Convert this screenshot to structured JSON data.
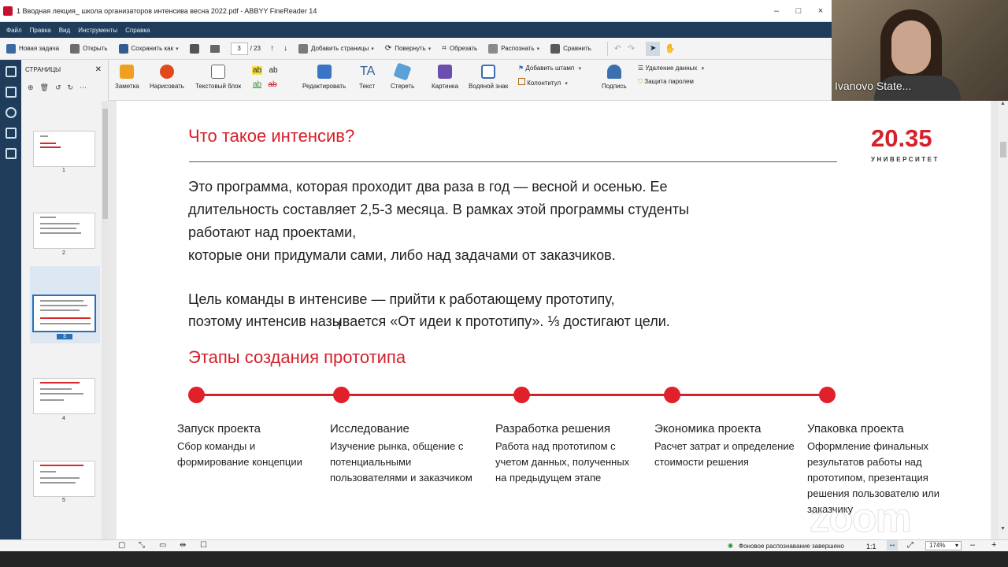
{
  "window": {
    "title": "1 Вводная лекция_ школа организаторов интенсива весна 2022.pdf - ABBYY FineReader 14",
    "controls": [
      "–",
      "□",
      "×"
    ]
  },
  "menu": [
    "Файл",
    "Правка",
    "Вид",
    "Инструменты",
    "Справка"
  ],
  "toolbar1": {
    "new_task": "Новая задача",
    "open": "Открыть",
    "save_as": "Сохранить как",
    "page_current": "3",
    "page_total": "/ 23",
    "add_pages": "Добавить страницы",
    "rotate": "Повернуть",
    "crop": "Обрезать",
    "recognize": "Распознать",
    "compare": "Сравнить"
  },
  "toolbar2": {
    "note": "Заметка",
    "draw": "Нарисовать",
    "text_block": "Текстовый блок",
    "edit": "Редактировать",
    "text": "Текст",
    "erase": "Стереть",
    "picture": "Картинка",
    "watermark": "Водяной знак",
    "add_stamp": "Добавить штамп",
    "header_footer": "Колонтитул",
    "signature": "Подпись",
    "remove_data": "Удаление данных",
    "password": "Защита паролем"
  },
  "pages_panel": {
    "title": "СТРАНИЦЫ",
    "page_numbers": [
      "1",
      "2",
      "3",
      "4",
      "5"
    ],
    "selected": "3"
  },
  "slide": {
    "title": "Что такое интенсив?",
    "logo_number": "20.35",
    "logo_text": "УНИВЕРСИТЕТ",
    "paragraph_lines": [
      "Это программа, которая проходит два раза в год — весной и осенью. Ее",
      "длительность составляет 2,5-3 месяца. В рамках этой программы студенты",
      "работают над проектами,",
      "которые они придумали сами, либо над задачами от заказчиков."
    ],
    "goal_lines": [
      "Цель команды в интенсиве — прийти к работающему прототипу,",
      "поэтому интенсив называется «От идеи к прототипу». ⅓ достигают цели."
    ],
    "stages_title": "Этапы создания прототипа",
    "stages": [
      {
        "title": "Запуск проекта",
        "desc": "Сбор команды и формирование концепции"
      },
      {
        "title": "Исследование",
        "desc": "Изучение рынка, общение с потенциальными пользователями и заказчиком"
      },
      {
        "title": "Разработка решения",
        "desc": "Работа над прототипом с учетом данных, полученных на предыдущем этапе"
      },
      {
        "title": "Экономика проекта",
        "desc": "Расчет затрат и определение стоимости решения"
      },
      {
        "title": "Упаковка проекта",
        "desc": "Оформление финальных результатов работы над прототипом, презентация решения пользователю или заказчику"
      }
    ]
  },
  "status_bar": {
    "ocr_status": "Фоновое распознавание завершено",
    "ratio": "1:1",
    "zoom": "174%",
    "minus": "–",
    "plus": "+"
  },
  "video": {
    "participant_name": "Ivanovo State..."
  },
  "watermark": "zoom",
  "colors": {
    "accent_red": "#d6202a",
    "menu_blue": "#1f3d5a",
    "toolbar_bg": "#f4f4f4"
  }
}
